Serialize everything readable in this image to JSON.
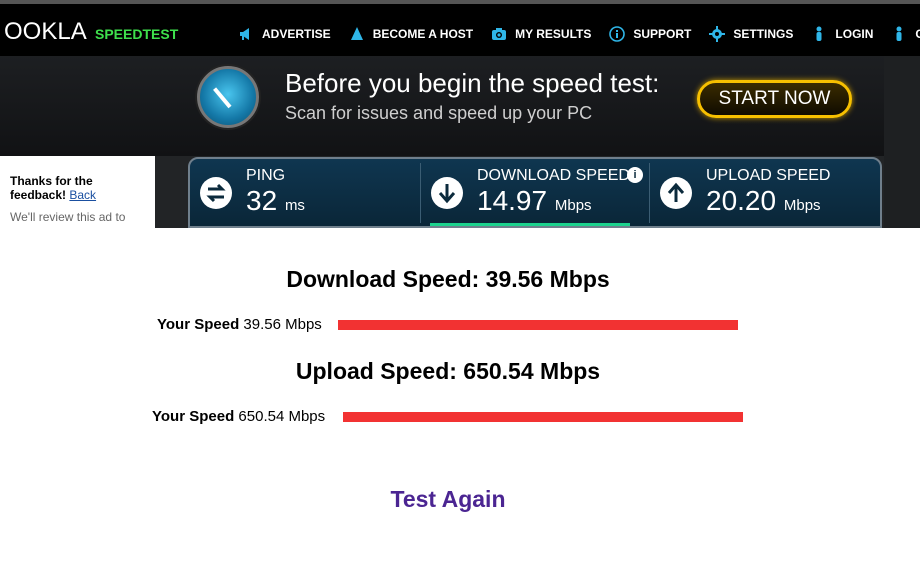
{
  "header": {
    "logo": "OOKLA",
    "brand": "SPEEDTEST",
    "nav": [
      {
        "label": "ADVERTISE",
        "icon": "megaphone-icon"
      },
      {
        "label": "BECOME A HOST",
        "icon": "host-icon"
      },
      {
        "label": "MY RESULTS",
        "icon": "camera-icon"
      },
      {
        "label": "SUPPORT",
        "icon": "info-icon"
      },
      {
        "label": "SETTINGS",
        "icon": "gear-icon"
      },
      {
        "label": "LOGIN",
        "icon": "person-icon"
      },
      {
        "label": "CR",
        "icon": "person-icon"
      }
    ]
  },
  "banner": {
    "title": "Before you begin the speed test:",
    "subtitle": "Scan for issues and speed up your PC",
    "button": "START NOW"
  },
  "feedback": {
    "thanks": "Thanks for the feedback!",
    "back": "Back",
    "review": "We'll review this ad to"
  },
  "results": {
    "ping": {
      "label": "PING",
      "value": "32",
      "unit": "ms"
    },
    "download": {
      "label": "DOWNLOAD SPEED",
      "value": "14.97",
      "unit": "Mbps"
    },
    "upload": {
      "label": "UPLOAD SPEED",
      "value": "20.20",
      "unit": "Mbps"
    }
  },
  "report": {
    "download_title": "Download Speed: 39.56 Mbps",
    "upload_title": "Upload Speed: 650.54 Mbps",
    "your_speed_label": "Your Speed",
    "download_value": "39.56 Mbps",
    "upload_value": "650.54 Mbps",
    "test_again": "Test Again"
  },
  "colors": {
    "brand_green": "#3ee04c",
    "nav_icon_blue": "#2fb6e8",
    "bar_red": "#f23232",
    "link_purple": "#4b2592",
    "start_button_gold": "#f7c000"
  }
}
